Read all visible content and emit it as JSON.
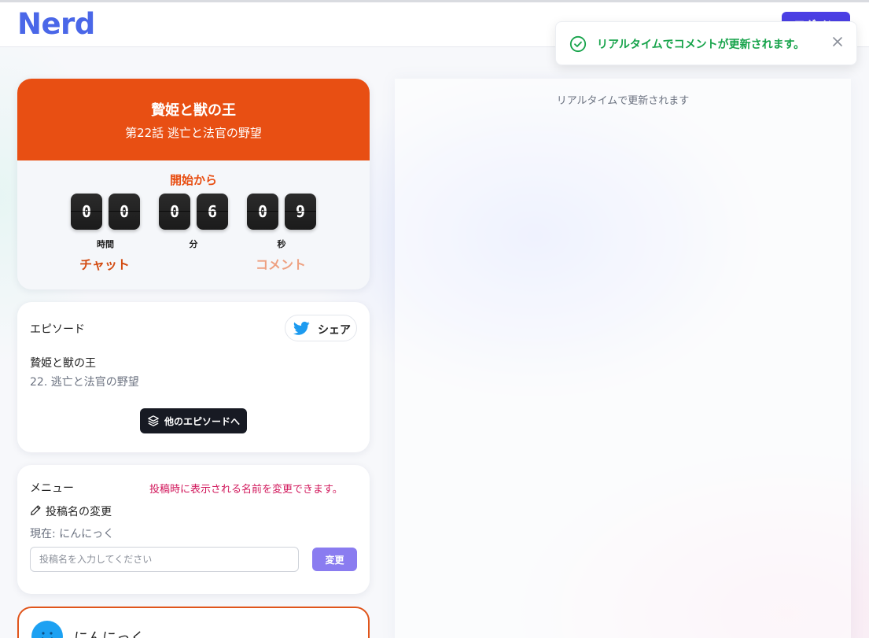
{
  "header": {
    "logo": "Nerd",
    "login_label": "ログイン"
  },
  "toast": {
    "message": "リアルタイムでコメントが更新されます。",
    "icon": "check-circle-icon",
    "close_icon": "close-icon",
    "color": "#16a34a"
  },
  "program": {
    "title": "贄姫と獣の王",
    "episode": "第22話 逃亡と法官の野望",
    "since_label": "開始から",
    "timer": {
      "hours": [
        "0",
        "0"
      ],
      "minutes": [
        "0",
        "6"
      ],
      "seconds": [
        "0",
        "9"
      ],
      "hours_label": "時間",
      "minutes_label": "分",
      "seconds_label": "秒"
    },
    "tabs": [
      {
        "label": "チャット",
        "active": true
      },
      {
        "label": "コメント",
        "active": false
      }
    ],
    "accent": "#e84f13"
  },
  "episode_card": {
    "label": "エピソード",
    "share_label": "シェア",
    "share_icon": "twitter-icon",
    "title": "贄姫と獣の王",
    "subtitle": "22. 逃亡と法官の野望",
    "other_label": "他のエピソードへ",
    "other_icon": "layers-icon"
  },
  "menu": {
    "label": "メニュー",
    "hint": "投稿時に表示される名前を変更できます。",
    "rename_label": "投稿名の変更",
    "current": "現在: にんにっく",
    "input_placeholder": "投稿名を入力してください",
    "input_value": "",
    "change_label": "変更"
  },
  "user": {
    "name": "にんにっく"
  },
  "right_panel": {
    "note": "リアルタイムで更新されます"
  }
}
